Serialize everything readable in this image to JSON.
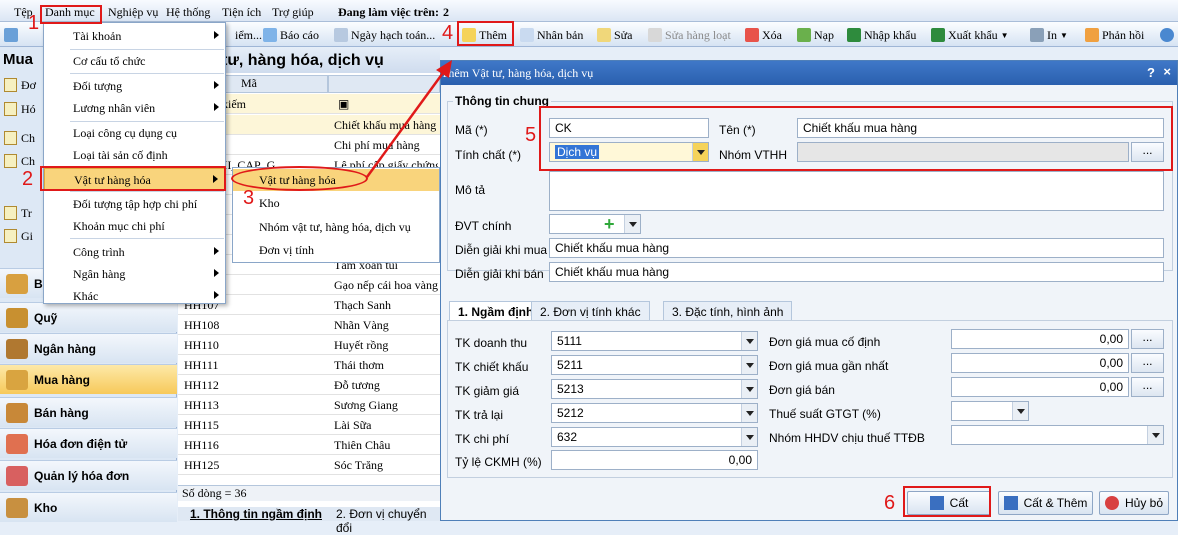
{
  "menubar": {
    "file": "Tệp",
    "catalog": "Danh mục",
    "ops": "Nghiệp vụ",
    "system": "Hệ thống",
    "utility": "Tiện ích",
    "help": "Trợ giúp",
    "working_label": "Đang làm việc trên:",
    "working_value": "2"
  },
  "toolbar": {
    "partial_left": "iểm...",
    "report": "Báo cáo",
    "accounting_date": "Ngày hạch toán...",
    "add": "Thêm",
    "duplicate": "Nhân bản",
    "edit": "Sửa",
    "bulk_edit": "Sửa hàng loạt",
    "delete": "Xóa",
    "load": "Nạp",
    "import": "Nhập khẩu",
    "export": "Xuất khẩu",
    "print": "In",
    "feedback": "Phản hồi"
  },
  "left": {
    "title": "Mua",
    "items": [
      "Đơ",
      "Hó",
      "Ch",
      "Ch",
      "Tr",
      "Gi"
    ],
    "modules": [
      "Bá",
      "Quỹ",
      "Ngân hàng",
      "Mua hàng",
      "Bán hàng",
      "Hóa đơn điện tử",
      "Quản lý hóa đơn",
      "Kho"
    ]
  },
  "center": {
    "title": "tư, hàng hóa, dịch vụ",
    "col_code": "Mã",
    "search_label": "kiếm",
    "rows": [
      {
        "code": "",
        "name": "Chiết khấu mua hàng"
      },
      {
        "code": "",
        "name": "Chi phí mua hàng"
      },
      {
        "code": "IEM_PHI_CAP_G",
        "name": "Lệ phí cấp giấy chứng"
      },
      {
        "code": "",
        "name": ""
      },
      {
        "code": "",
        "name": ""
      },
      {
        "code": "",
        "name": ""
      },
      {
        "code": "",
        "name": ""
      },
      {
        "code": "",
        "name": "Tám xoan túi"
      },
      {
        "code": "",
        "name": "Gạo nếp cái hoa vàng"
      },
      {
        "code": "HH107",
        "name": "Thạch Sanh"
      },
      {
        "code": "HH108",
        "name": "Nhãn Vàng"
      },
      {
        "code": "HH110",
        "name": "Huyết rồng"
      },
      {
        "code": "HH111",
        "name": "Thái thơm"
      },
      {
        "code": "HH112",
        "name": "Đỗ tương"
      },
      {
        "code": "HH113",
        "name": "Sương Giang"
      },
      {
        "code": "HH115",
        "name": "Lài Sữa"
      },
      {
        "code": "HH116",
        "name": "Thiên Châu"
      },
      {
        "code": "HH125",
        "name": "Sóc Trăng"
      }
    ],
    "footer": "Số dòng = 36",
    "tab1": "1. Thông tin ngầm định",
    "tab2": "2. Đơn vị chuyển đổi"
  },
  "dropdown": {
    "items": [
      "Tài khoản",
      "Cơ cấu tổ chức",
      "Đối tượng",
      "Lương nhân viên",
      "Loại công cụ dụng cụ",
      "Loại tài sản cố định",
      "Vật tư hàng hóa",
      "Đối tượng tập hợp chi phí",
      "Khoản mục chi phí",
      "Công trình",
      "Ngân hàng",
      "Khác"
    ]
  },
  "submenu": {
    "items": [
      "Vật tư hàng hóa",
      "Kho",
      "Nhóm vật tư, hàng hóa, dịch vụ",
      "Đơn vị tính"
    ]
  },
  "dialog": {
    "title": "Thêm Vật tư, hàng hóa, dịch vụ",
    "help": "?",
    "close": "×",
    "group": "Thông tin chung",
    "code_label": "Mã (*)",
    "code_value": "CK",
    "name_label": "Tên (*)",
    "name_value": "Chiết khấu mua hàng",
    "nature_label": "Tính chất (*)",
    "nature_value": "Dịch vụ",
    "group_label": "Nhóm VTHH",
    "group_value": "",
    "desc_label": "Mô tả",
    "unit_label": "ĐVT chính",
    "buy_desc_label": "Diễn giải khi mua",
    "buy_desc_value": "Chiết khấu mua hàng",
    "sell_desc_label": "Diễn giải khi bán",
    "sell_desc_value": "Chiết khấu mua hàng",
    "tabs": [
      "1. Ngầm định",
      "2. Đơn vị tính khác",
      "3. Đặc tính, hình ảnh"
    ],
    "tk": [
      {
        "label": "TK doanh thu",
        "value": "5111"
      },
      {
        "label": "TK chiết khấu",
        "value": "5211"
      },
      {
        "label": "TK giảm giá",
        "value": "5213"
      },
      {
        "label": "TK trả lại",
        "value": "5212"
      },
      {
        "label": "TK chi phí",
        "value": "632"
      }
    ],
    "ckmh_label": "Tỷ lệ CKMH (%)",
    "ckmh_value": "0,00",
    "prices": [
      {
        "label": "Đơn giá mua cố định",
        "value": "0,00"
      },
      {
        "label": "Đơn giá mua gần nhất",
        "value": "0,00"
      },
      {
        "label": "Đơn giá bán",
        "value": "0,00"
      }
    ],
    "vat_label": "Thuế suất GTGT (%)",
    "ttdb_label": "Nhóm HHDV chịu thuế TTĐB",
    "ellipsis": "...",
    "save": "Cất",
    "save_add": "Cất & Thêm",
    "cancel": "Hủy bỏ"
  },
  "annotations": [
    "1",
    "2",
    "3",
    "4",
    "5",
    "6"
  ],
  "colors": {
    "accent_red": "#e01919",
    "title_blue": "#2a5fae",
    "highlight": "#f9d47c"
  }
}
